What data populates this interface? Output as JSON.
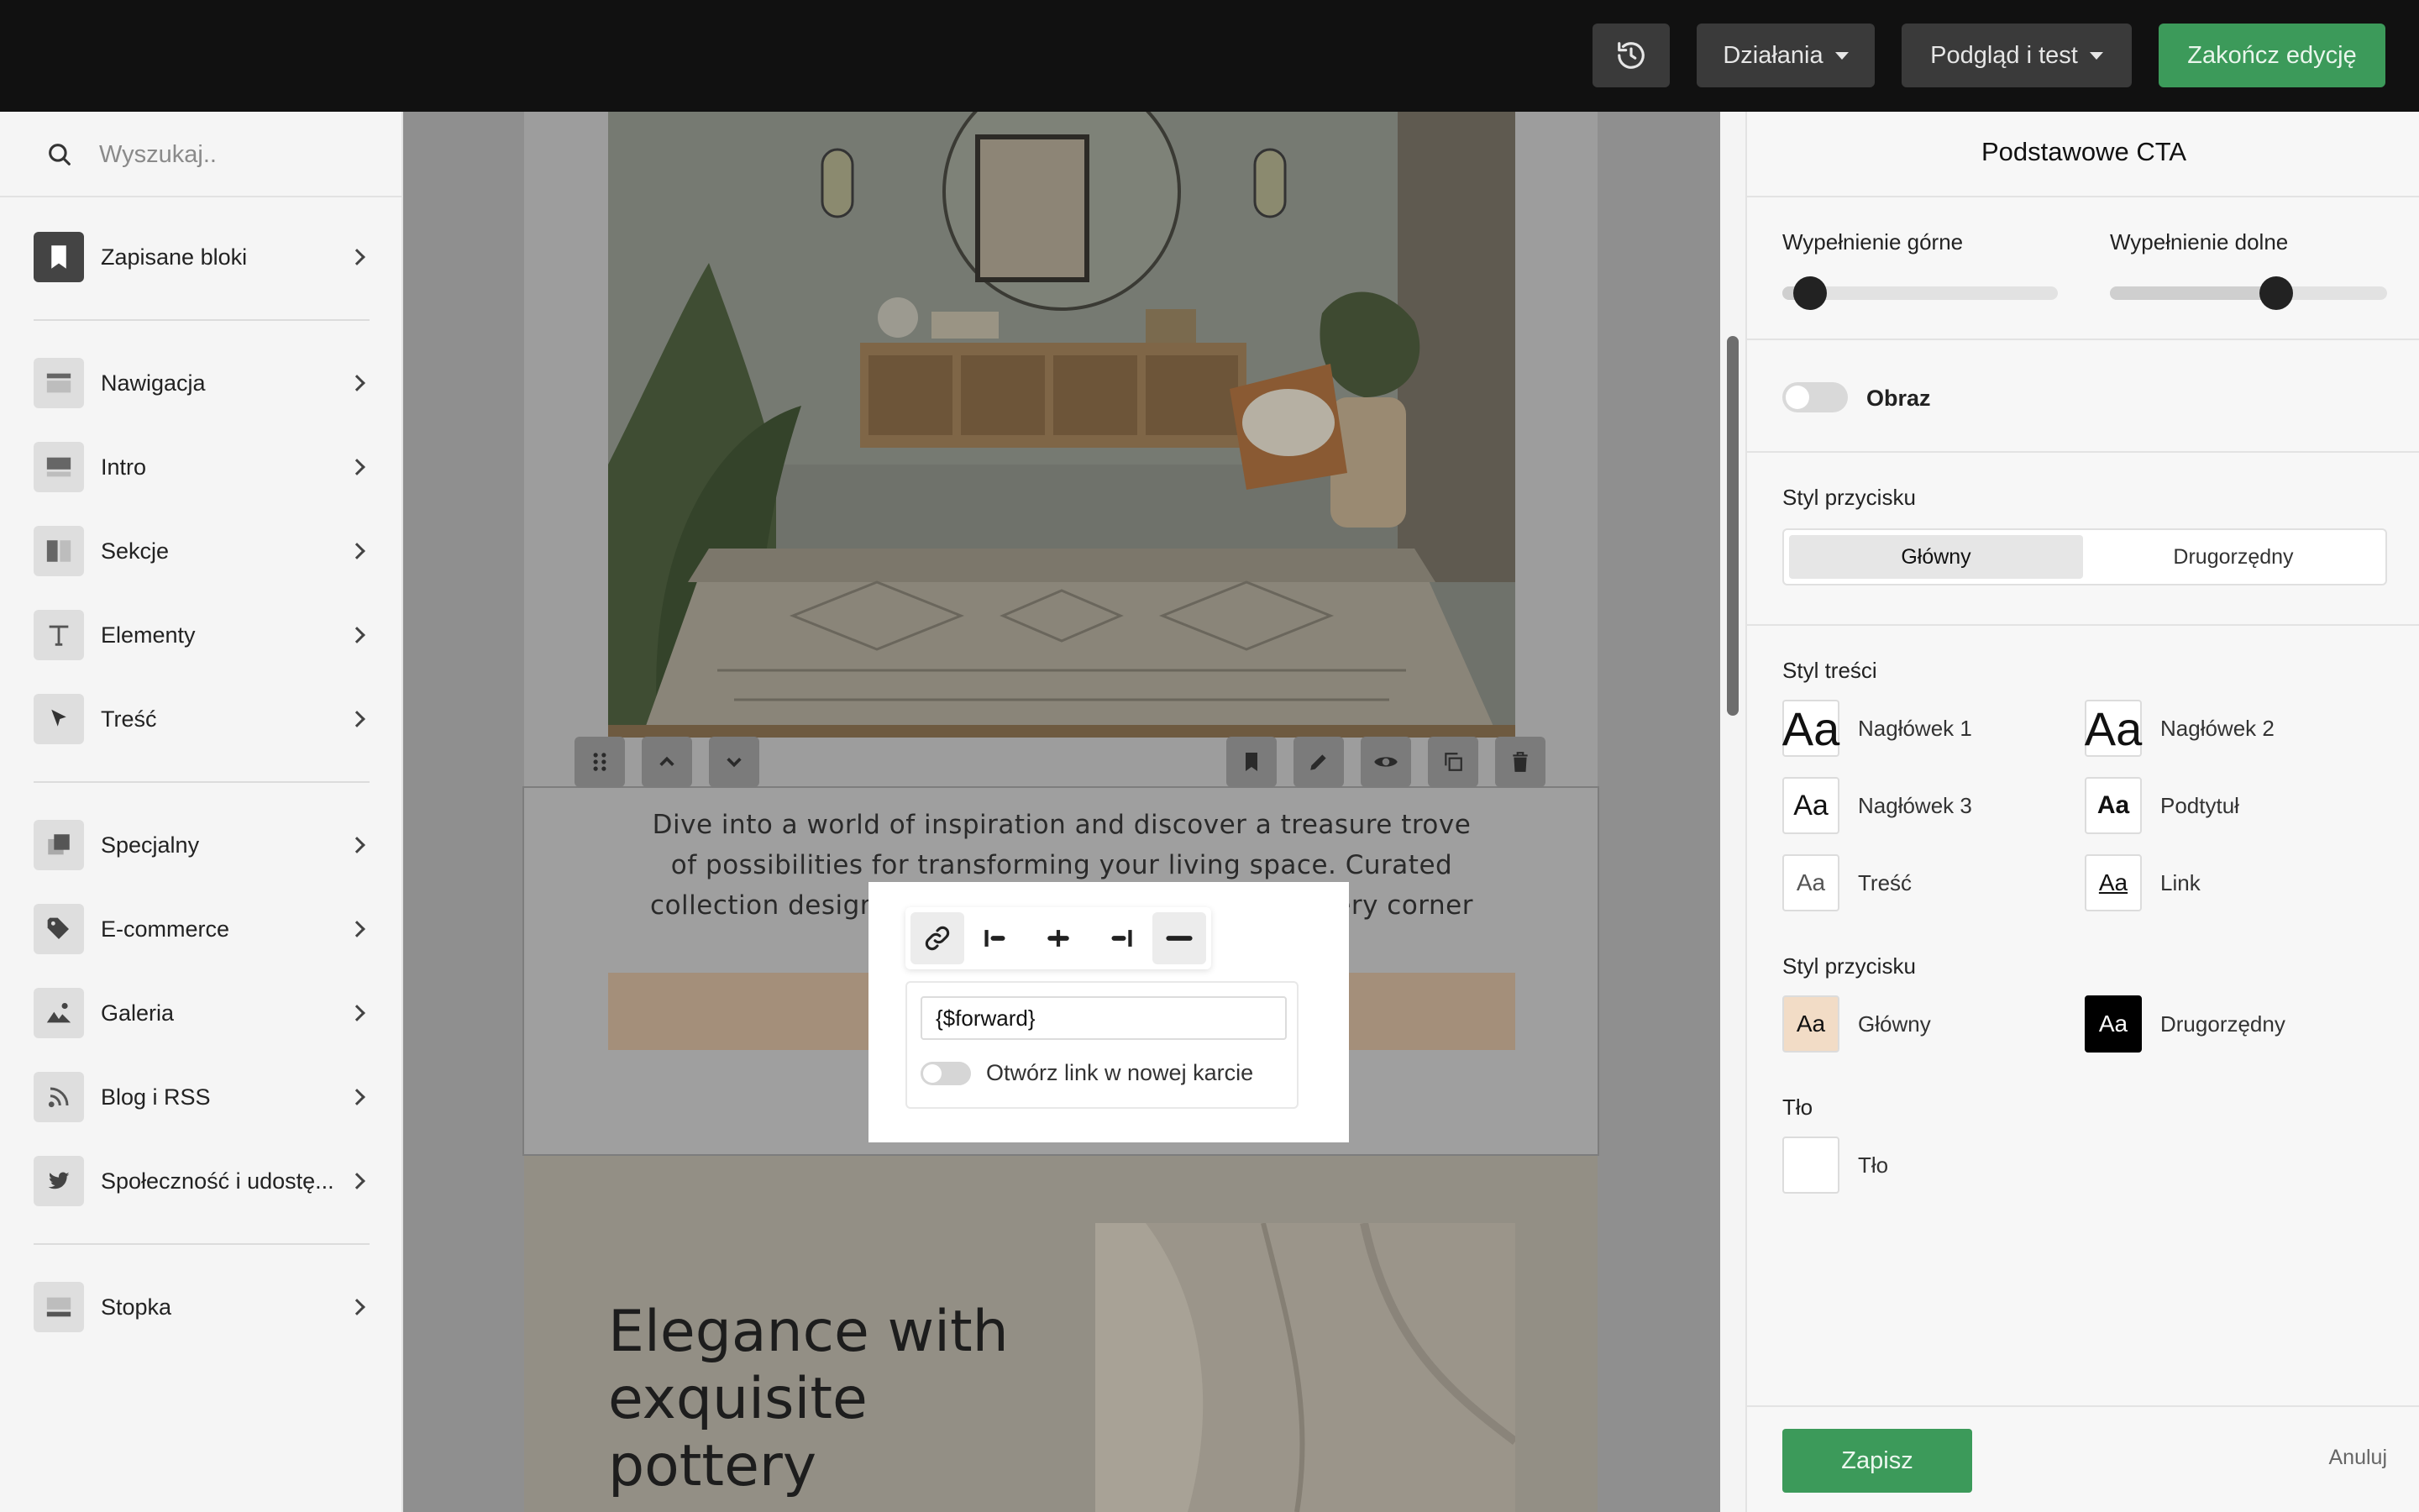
{
  "toolbar": {
    "history_icon": "history-icon",
    "actions_label": "Działania",
    "preview_label": "Podgląd i test",
    "finish_label": "Zakończ edycję",
    "accent_color": "#3c9a5a"
  },
  "sidebar": {
    "search_placeholder": "Wyszukaj..",
    "items": [
      {
        "label": "Zapisane bloki",
        "icon": "bookmark-icon"
      },
      {
        "label": "Nawigacja",
        "icon": "navigation-block-icon"
      },
      {
        "label": "Intro",
        "icon": "intro-block-icon"
      },
      {
        "label": "Sekcje",
        "icon": "sections-block-icon"
      },
      {
        "label": "Elementy",
        "icon": "text-t-icon"
      },
      {
        "label": "Treść",
        "icon": "cursor-arrow-icon"
      },
      {
        "label": "Specjalny",
        "icon": "layers-icon"
      },
      {
        "label": "E-commerce",
        "icon": "tag-icon"
      },
      {
        "label": "Galeria",
        "icon": "image-icon"
      },
      {
        "label": "Blog i RSS",
        "icon": "rss-icon"
      },
      {
        "label": "Społeczność i udostę...",
        "icon": "twitter-bird-icon"
      },
      {
        "label": "Stopka",
        "icon": "footer-block-icon"
      }
    ]
  },
  "canvas": {
    "cta_text": "Dive into a world of inspiration and discover a treasure trove of possibilities for transforming your living space. Curated collection designed to bring beauty and style to every corner of your abode.",
    "section_title": "Elegance with exquisite pottery",
    "block_toolbar_left": [
      "drag-handle-icon",
      "arrow-up-icon",
      "arrow-down-icon"
    ],
    "block_toolbar_right": [
      "bookmark-icon",
      "pencil-icon",
      "eye-icon",
      "copy-icon",
      "trash-icon"
    ],
    "popover": {
      "tools": [
        "link-icon",
        "align-left-icon",
        "align-center-icon",
        "align-right-icon",
        "full-width-icon"
      ],
      "url_value": "{$forward}",
      "new_tab_label": "Otwórz link w nowej karcie"
    }
  },
  "panel": {
    "title": "Podstawowe CTA",
    "padding_top_label": "Wypełnienie górne",
    "padding_bottom_label": "Wypełnienie dolne",
    "padding_top_value": 0.1,
    "padding_bottom_value": 0.6,
    "image_label": "Obraz",
    "button_style_label": "Styl przycisku",
    "button_style_options": [
      "Główny",
      "Drugorzędny"
    ],
    "button_style_selected": "Główny",
    "content_style_label": "Styl treści",
    "content_styles": [
      {
        "name": "Nagłówek 1",
        "sample": "Aa"
      },
      {
        "name": "Nagłówek 2",
        "sample": "Aa"
      },
      {
        "name": "Nagłówek 3",
        "sample": "Aa"
      },
      {
        "name": "Podtytuł",
        "sample": "Aa"
      },
      {
        "name": "Treść",
        "sample": "Aa"
      },
      {
        "name": "Link",
        "sample": "Aa"
      }
    ],
    "button_style2_label": "Styl przycisku",
    "button_styles": [
      {
        "name": "Główny",
        "sample": "Aa",
        "bg": "#f2dcc6"
      },
      {
        "name": "Drugorzędny",
        "sample": "Aa",
        "bg": "#000000"
      }
    ],
    "background_label": "Tło",
    "background_item": "Tło",
    "save_label": "Zapisz",
    "cancel_label": "Anuluj"
  }
}
